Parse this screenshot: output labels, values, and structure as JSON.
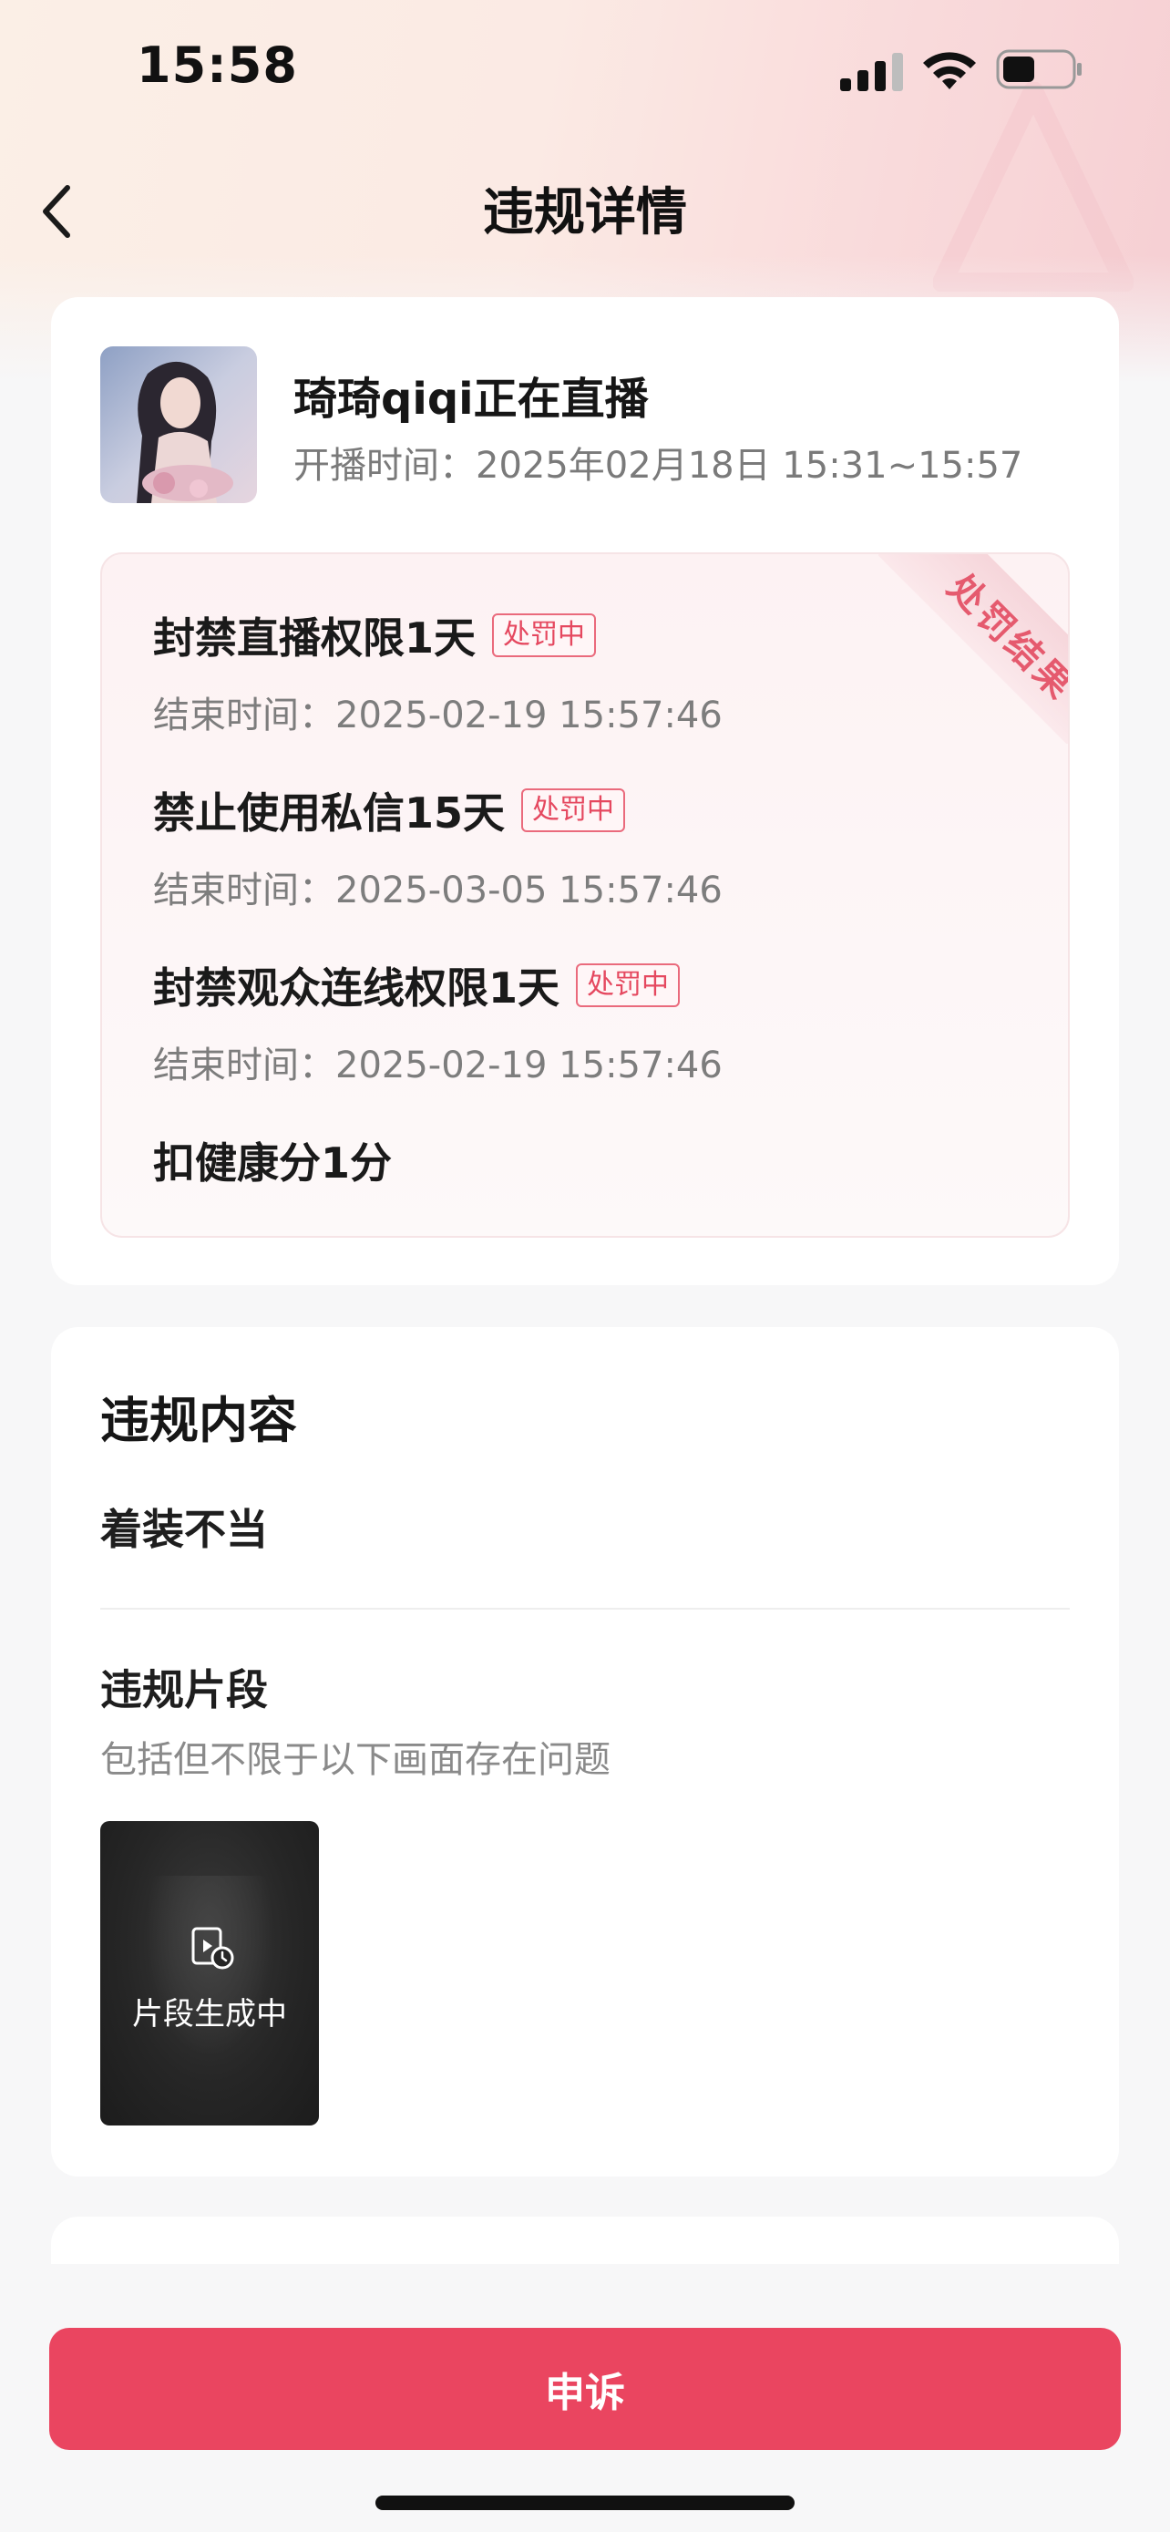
{
  "status_bar": {
    "time": "15:58"
  },
  "header": {
    "title": "违规详情"
  },
  "live": {
    "streamer_title": "琦琦qiqi正在直播",
    "live_time": "开播时间：2025年02月18日 15:31~15:57"
  },
  "penalty": {
    "ribbon": "处罚结果",
    "items": [
      {
        "label": "封禁直播权限1天",
        "badge": "处罚中",
        "end": "结束时间：2025-02-19 15:57:46"
      },
      {
        "label": "禁止使用私信15天",
        "badge": "处罚中",
        "end": "结束时间：2025-03-05 15:57:46"
      },
      {
        "label": "封禁观众连线权限1天",
        "badge": "处罚中",
        "end": "结束时间：2025-02-19 15:57:46"
      },
      {
        "label": "扣健康分1分"
      }
    ]
  },
  "violation": {
    "section_title": "违规内容",
    "type": "着装不当",
    "clip_title": "违规片段",
    "clip_desc": "包括但不限于以下画面存在问题",
    "clip_status": "片段生成中"
  },
  "actions": {
    "appeal": "申诉"
  },
  "colors": {
    "accent": "#ea4560",
    "badge_text": "#e5485f"
  }
}
